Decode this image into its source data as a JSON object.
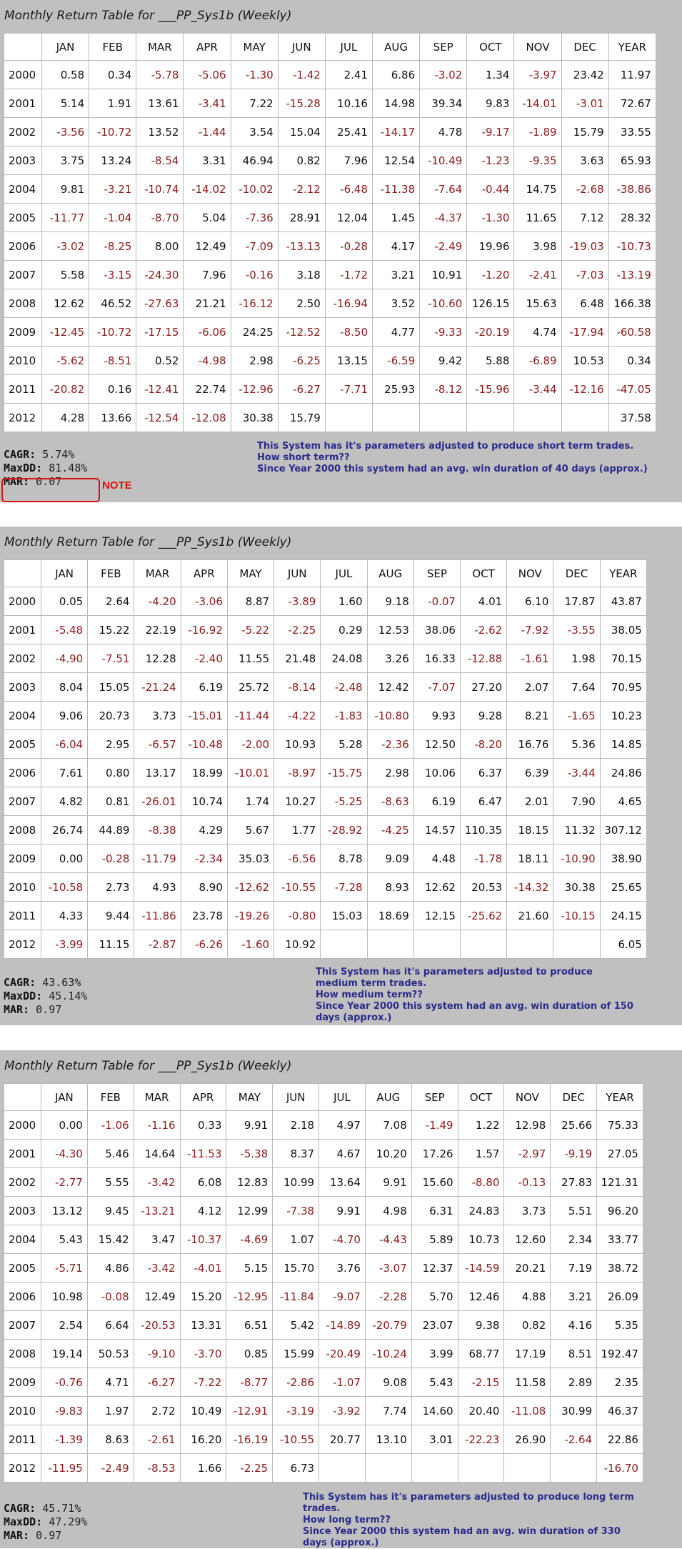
{
  "months": [
    "JAN",
    "FEB",
    "MAR",
    "APR",
    "MAY",
    "JUN",
    "JUL",
    "AUG",
    "SEP",
    "OCT",
    "NOV",
    "DEC",
    "YEAR"
  ],
  "colors": {
    "positive": "#111111",
    "negative": "#8b1a1a",
    "note": "#e01010",
    "description": "#2a2a8a",
    "panel_background": "#c0c0c0"
  },
  "panels": [
    {
      "title": "Monthly Return Table for ___PP_Sys1b (Weekly)",
      "rows": [
        {
          "year": "2000",
          "values": [
            "0.58",
            "0.34",
            "-5.78",
            "-5.06",
            "-1.30",
            "-1.42",
            "2.41",
            "6.86",
            "-3.02",
            "1.34",
            "-3.97",
            "23.42",
            "11.97"
          ]
        },
        {
          "year": "2001",
          "values": [
            "5.14",
            "1.91",
            "13.61",
            "-3.41",
            "7.22",
            "-15.28",
            "10.16",
            "14.98",
            "39.34",
            "9.83",
            "-14.01",
            "-3.01",
            "72.67"
          ]
        },
        {
          "year": "2002",
          "values": [
            "-3.56",
            "-10.72",
            "13.52",
            "-1.44",
            "3.54",
            "15.04",
            "25.41",
            "-14.17",
            "4.78",
            "-9.17",
            "-1.89",
            "15.79",
            "33.55"
          ]
        },
        {
          "year": "2003",
          "values": [
            "3.75",
            "13.24",
            "-8.54",
            "3.31",
            "46.94",
            "0.82",
            "7.96",
            "12.54",
            "-10.49",
            "-1.23",
            "-9.35",
            "3.63",
            "65.93"
          ]
        },
        {
          "year": "2004",
          "values": [
            "9.81",
            "-3.21",
            "-10.74",
            "-14.02",
            "-10.02",
            "-2.12",
            "-6.48",
            "-11.38",
            "-7.64",
            "-0.44",
            "14.75",
            "-2.68",
            "-38.86"
          ]
        },
        {
          "year": "2005",
          "values": [
            "-11.77",
            "-1.04",
            "-8.70",
            "5.04",
            "-7.36",
            "28.91",
            "12.04",
            "1.45",
            "-4.37",
            "-1.30",
            "11.65",
            "7.12",
            "28.32"
          ]
        },
        {
          "year": "2006",
          "values": [
            "-3.02",
            "-8.25",
            "8.00",
            "12.49",
            "-7.09",
            "-13.13",
            "-0.28",
            "4.17",
            "-2.49",
            "19.96",
            "3.98",
            "-19.03",
            "-10.73"
          ]
        },
        {
          "year": "2007",
          "values": [
            "5.58",
            "-3.15",
            "-24.30",
            "7.96",
            "-0.16",
            "3.18",
            "-1.72",
            "3.21",
            "10.91",
            "-1.20",
            "-2.41",
            "-7.03",
            "-13.19"
          ]
        },
        {
          "year": "2008",
          "values": [
            "12.62",
            "46.52",
            "-27.63",
            "21.21",
            "-16.12",
            "2.50",
            "-16.94",
            "3.52",
            "-10.60",
            "126.15",
            "15.63",
            "6.48",
            "166.38"
          ]
        },
        {
          "year": "2009",
          "values": [
            "-12.45",
            "-10.72",
            "-17.15",
            "-6.06",
            "24.25",
            "-12.52",
            "-8.50",
            "4.77",
            "-9.33",
            "-20.19",
            "4.74",
            "-17.94",
            "-60.58"
          ]
        },
        {
          "year": "2010",
          "values": [
            "-5.62",
            "-8.51",
            "0.52",
            "-4.98",
            "2.98",
            "-6.25",
            "13.15",
            "-6.59",
            "9.42",
            "5.88",
            "-6.89",
            "10.53",
            "0.34"
          ]
        },
        {
          "year": "2011",
          "values": [
            "-20.82",
            "0.16",
            "-12.41",
            "22.74",
            "-12.96",
            "-6.27",
            "-7.71",
            "25.93",
            "-8.12",
            "-15.96",
            "-3.44",
            "-12.16",
            "-47.05"
          ]
        },
        {
          "year": "2012",
          "values": [
            "4.28",
            "13.66",
            "-12.54",
            "-12.08",
            "30.38",
            "15.79",
            "",
            "",
            "",
            "",
            "",
            "",
            "37.58"
          ]
        }
      ],
      "stats": [
        {
          "label": "CAGR:",
          "value": "5.74%"
        },
        {
          "label": "MaxDD:",
          "value": "81.48%"
        },
        {
          "label": "MAR:",
          "value": "0.07"
        }
      ],
      "note": "NOTE",
      "description": [
        "This System has it's parameters adjusted to produce short term trades.",
        "How short term??",
        "Since Year 2000 this system had an avg. win duration of 40 days (approx.)"
      ]
    },
    {
      "title": "Monthly Return Table for ___PP_Sys1b (Weekly)",
      "rows": [
        {
          "year": "2000",
          "values": [
            "0.05",
            "2.64",
            "-4.20",
            "-3.06",
            "8.87",
            "-3.89",
            "1.60",
            "9.18",
            "-0.07",
            "4.01",
            "6.10",
            "17.87",
            "43.87"
          ]
        },
        {
          "year": "2001",
          "values": [
            "-5.48",
            "15.22",
            "22.19",
            "-16.92",
            "-5.22",
            "-2.25",
            "0.29",
            "12.53",
            "38.06",
            "-2.62",
            "-7.92",
            "-3.55",
            "38.05"
          ]
        },
        {
          "year": "2002",
          "values": [
            "-4.90",
            "-7.51",
            "12.28",
            "-2.40",
            "11.55",
            "21.48",
            "24.08",
            "3.26",
            "16.33",
            "-12.88",
            "-1.61",
            "1.98",
            "70.15"
          ]
        },
        {
          "year": "2003",
          "values": [
            "8.04",
            "15.05",
            "-21.24",
            "6.19",
            "25.72",
            "-8.14",
            "-2.48",
            "12.42",
            "-7.07",
            "27.20",
            "2.07",
            "7.64",
            "70.95"
          ]
        },
        {
          "year": "2004",
          "values": [
            "9.06",
            "20.73",
            "3.73",
            "-15.01",
            "-11.44",
            "-4.22",
            "-1.83",
            "-10.80",
            "9.93",
            "9.28",
            "8.21",
            "-1.65",
            "10.23"
          ]
        },
        {
          "year": "2005",
          "values": [
            "-6.04",
            "2.95",
            "-6.57",
            "-10.48",
            "-2.00",
            "10.93",
            "5.28",
            "-2.36",
            "12.50",
            "-8.20",
            "16.76",
            "5.36",
            "14.85"
          ]
        },
        {
          "year": "2006",
          "values": [
            "7.61",
            "0.80",
            "13.17",
            "18.99",
            "-10.01",
            "-8.97",
            "-15.75",
            "2.98",
            "10.06",
            "6.37",
            "6.39",
            "-3.44",
            "24.86"
          ]
        },
        {
          "year": "2007",
          "values": [
            "4.82",
            "0.81",
            "-26.01",
            "10.74",
            "1.74",
            "10.27",
            "-5.25",
            "-8.63",
            "6.19",
            "6.47",
            "2.01",
            "7.90",
            "4.65"
          ]
        },
        {
          "year": "2008",
          "values": [
            "26.74",
            "44.89",
            "-8.38",
            "4.29",
            "5.67",
            "1.77",
            "-28.92",
            "-4.25",
            "14.57",
            "110.35",
            "18.15",
            "11.32",
            "307.12"
          ]
        },
        {
          "year": "2009",
          "values": [
            "0.00",
            "-0.28",
            "-11.79",
            "-2.34",
            "35.03",
            "-6.56",
            "8.78",
            "9.09",
            "4.48",
            "-1.78",
            "18.11",
            "-10.90",
            "38.90"
          ]
        },
        {
          "year": "2010",
          "values": [
            "-10.58",
            "2.73",
            "4.93",
            "8.90",
            "-12.62",
            "-10.55",
            "-7.28",
            "8.93",
            "12.62",
            "20.53",
            "-14.32",
            "30.38",
            "25.65"
          ]
        },
        {
          "year": "2011",
          "values": [
            "4.33",
            "9.44",
            "-11.86",
            "23.78",
            "-19.26",
            "-0.80",
            "15.03",
            "18.69",
            "12.15",
            "-25.62",
            "21.60",
            "-10.15",
            "24.15"
          ]
        },
        {
          "year": "2012",
          "values": [
            "-3.99",
            "11.15",
            "-2.87",
            "-6.26",
            "-1.60",
            "10.92",
            "",
            "",
            "",
            "",
            "",
            "",
            "6.05"
          ]
        }
      ],
      "stats": [
        {
          "label": "CAGR:",
          "value": "43.63%"
        },
        {
          "label": "MaxDD:",
          "value": "45.14%"
        },
        {
          "label": "MAR:",
          "value": "0.97"
        }
      ],
      "description": [
        "This System has it's parameters adjusted to produce medium term trades.",
        "How medium term??",
        "Since Year 2000 this system had an avg. win duration of 150 days (approx.)"
      ]
    },
    {
      "title": "Monthly Return Table for ___PP_Sys1b (Weekly)",
      "rows": [
        {
          "year": "2000",
          "values": [
            "0.00",
            "-1.06",
            "-1.16",
            "0.33",
            "9.91",
            "2.18",
            "4.97",
            "7.08",
            "-1.49",
            "1.22",
            "12.98",
            "25.66",
            "75.33"
          ]
        },
        {
          "year": "2001",
          "values": [
            "-4.30",
            "5.46",
            "14.64",
            "-11.53",
            "-5.38",
            "8.37",
            "4.67",
            "10.20",
            "17.26",
            "1.57",
            "-2.97",
            "-9.19",
            "27.05"
          ]
        },
        {
          "year": "2002",
          "values": [
            "-2.77",
            "5.55",
            "-3.42",
            "6.08",
            "12.83",
            "10.99",
            "13.64",
            "9.91",
            "15.60",
            "-8.80",
            "-0.13",
            "27.83",
            "121.31"
          ]
        },
        {
          "year": "2003",
          "values": [
            "13.12",
            "9.45",
            "-13.21",
            "4.12",
            "12.99",
            "-7.38",
            "9.91",
            "4.98",
            "6.31",
            "24.83",
            "3.73",
            "5.51",
            "96.20"
          ]
        },
        {
          "year": "2004",
          "values": [
            "5.43",
            "15.42",
            "3.47",
            "-10.37",
            "-4.69",
            "1.07",
            "-4.70",
            "-4.43",
            "5.89",
            "10.73",
            "12.60",
            "2.34",
            "33.77"
          ]
        },
        {
          "year": "2005",
          "values": [
            "-5.71",
            "4.86",
            "-3.42",
            "-4.01",
            "5.15",
            "15.70",
            "3.76",
            "-3.07",
            "12.37",
            "-14.59",
            "20.21",
            "7.19",
            "38.72"
          ]
        },
        {
          "year": "2006",
          "values": [
            "10.98",
            "-0.08",
            "12.49",
            "15.20",
            "-12.95",
            "-11.84",
            "-9.07",
            "-2.28",
            "5.70",
            "12.46",
            "4.88",
            "3.21",
            "26.09"
          ]
        },
        {
          "year": "2007",
          "values": [
            "2.54",
            "6.64",
            "-20.53",
            "13.31",
            "6.51",
            "5.42",
            "-14.89",
            "-20.79",
            "23.07",
            "9.38",
            "0.82",
            "4.16",
            "5.35"
          ]
        },
        {
          "year": "2008",
          "values": [
            "19.14",
            "50.53",
            "-9.10",
            "-3.70",
            "0.85",
            "15.99",
            "-20.49",
            "-10.24",
            "3.99",
            "68.77",
            "17.19",
            "8.51",
            "192.47"
          ]
        },
        {
          "year": "2009",
          "values": [
            "-0.76",
            "4.71",
            "-6.27",
            "-7.22",
            "-8.77",
            "-2.86",
            "-1.07",
            "9.08",
            "5.43",
            "-2.15",
            "11.58",
            "2.89",
            "2.35"
          ]
        },
        {
          "year": "2010",
          "values": [
            "-9.83",
            "1.97",
            "2.72",
            "10.49",
            "-12.91",
            "-3.19",
            "-3.92",
            "7.74",
            "14.60",
            "20.40",
            "-11.08",
            "30.99",
            "46.37"
          ]
        },
        {
          "year": "2011",
          "values": [
            "-1.39",
            "8.63",
            "-2.61",
            "16.20",
            "-16.19",
            "-10.55",
            "20.77",
            "13.10",
            "3.01",
            "-22.23",
            "26.90",
            "-2.64",
            "22.86"
          ]
        },
        {
          "year": "2012",
          "values": [
            "-11.95",
            "-2.49",
            "-8.53",
            "1.66",
            "-2.25",
            "6.73",
            "",
            "",
            "",
            "",
            "",
            "",
            "-16.70"
          ]
        }
      ],
      "stats": [
        {
          "label": "CAGR:",
          "value": "45.71%"
        },
        {
          "label": "MaxDD:",
          "value": "47.29%"
        },
        {
          "label": "MAR:",
          "value": "0.97"
        }
      ],
      "description": [
        "This System has it's parameters adjusted to produce long term trades.",
        "How long term??",
        "Since Year 2000 this system had an avg. win duration of 330 days (approx.)"
      ]
    }
  ]
}
